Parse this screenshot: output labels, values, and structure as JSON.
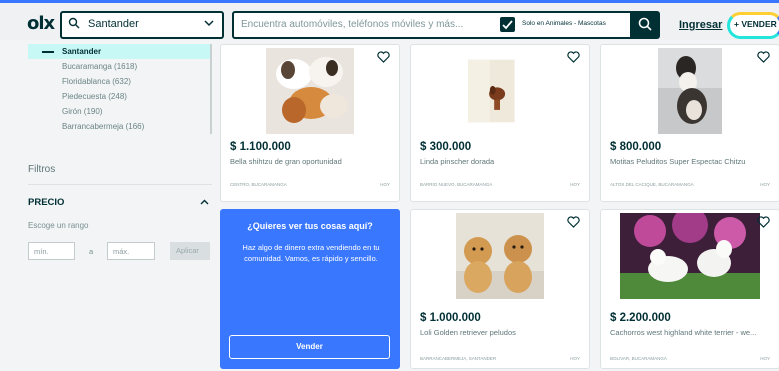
{
  "header": {
    "logo": "olx",
    "location_value": "Santander",
    "search_placeholder": "Encuentra automóviles, teléfonos móviles y más...",
    "checkbox_label": "Solo en Animales - Mascotas",
    "login_label": "Ingresar",
    "sell_label": "+ VENDER"
  },
  "sidebar": {
    "selected_location": "Santander",
    "locations": [
      "Bucaramanga (1618)",
      "Floridablanca (632)",
      "Piedecuesta (248)",
      "Girón (190)",
      "Barrancabermeja (166)"
    ],
    "filters_label": "Filtros",
    "price_label": "PRECIO",
    "range_label": "Escoge un rango",
    "min_placeholder": "mín.",
    "to_label": "a",
    "max_placeholder": "máx.",
    "apply_label": "Aplicar"
  },
  "listings": [
    {
      "price": "$ 1.100.000",
      "title": "Bella shihtzu de gran oportunidad",
      "location": "CENTRO, BUCARAMANGA",
      "date": "HOY"
    },
    {
      "price": "$ 300.000",
      "title": "Linda pinscher dorada",
      "location": "BARRIO NUEVO, BUCARAMANGA",
      "date": "HOY"
    },
    {
      "price": "$ 800.000",
      "title": "Motitas Peluditos Super Espectac Chitzu",
      "location": "ALTOS DEL CACIQUE, BUCARAMANGA",
      "date": "HOY"
    },
    {
      "price": "$ 1.000.000",
      "title": "Loli Golden retriever peludos",
      "location": "BARRANCABERMEJA, SANTANDER",
      "date": "HOY"
    },
    {
      "price": "$ 2.200.000",
      "title": "Cachorros west highland white terrier - we...",
      "location": "BOLIVAR, BUCARAMANGA",
      "date": "HOY"
    }
  ],
  "promo": {
    "title": "¿Quieres ver tus cosas aquí?",
    "body": "Haz algo de dinero extra vendiendo en tu comunidad. Vamos, es rápido y sencillo.",
    "button_label": "Vender"
  },
  "colors": {
    "primary": "#002f34",
    "accent_blue": "#3a77ff",
    "selected_bg": "#c8f8f6"
  }
}
